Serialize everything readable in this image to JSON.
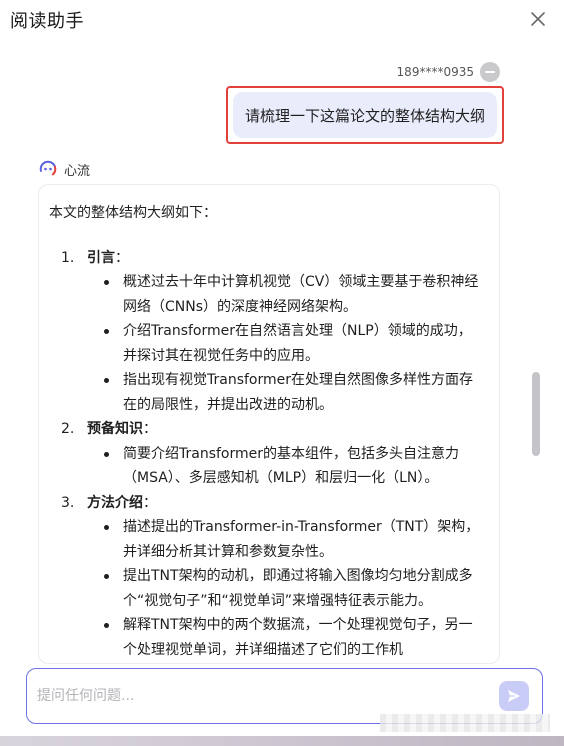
{
  "header": {
    "title": "阅读助手"
  },
  "user": {
    "id": "189****0935"
  },
  "query": {
    "text": "请梳理一下这篇论文的整体结构大纲"
  },
  "bot": {
    "name": "心流"
  },
  "answer": {
    "intro": "本文的整体结构大纲如下：",
    "sections": [
      {
        "num": "1.",
        "title": "引言",
        "sep": "：",
        "bullets": [
          "概述过去十年中计算机视觉（CV）领域主要基于卷积神经网络（CNNs）的深度神经网络架构。",
          "介绍Transformer在自然语言处理（NLP）领域的成功，并探讨其在视觉任务中的应用。",
          "指出现有视觉Transformer在处理自然图像多样性方面存在的局限性，并提出改进的动机。"
        ]
      },
      {
        "num": "2.",
        "title": "预备知识",
        "sep": "：",
        "bullets": [
          "简要介绍Transformer的基本组件，包括多头自注意力（MSA）、多层感知机（MLP）和层归一化（LN）。"
        ]
      },
      {
        "num": "3.",
        "title": "方法介绍",
        "sep": "：",
        "bullets": [
          "描述提出的Transformer-in-Transformer（TNT）架构，并详细分析其计算和参数复杂性。",
          "提出TNT架构的动机，即通过将输入图像均匀地分割成多个“视觉句子”和“视觉单词”来增强特征表示能力。",
          "解释TNT架构中的两个数据流，一个处理视觉句子，另一个处理视觉单词，并详细描述了它们的工作机"
        ]
      }
    ]
  },
  "input": {
    "placeholder": "提问任何问题..."
  },
  "colors": {
    "accent": "#6b73e8",
    "highlight": "#e2413a",
    "bubble": "#e9ecfb",
    "send": "#c9ccf6"
  }
}
